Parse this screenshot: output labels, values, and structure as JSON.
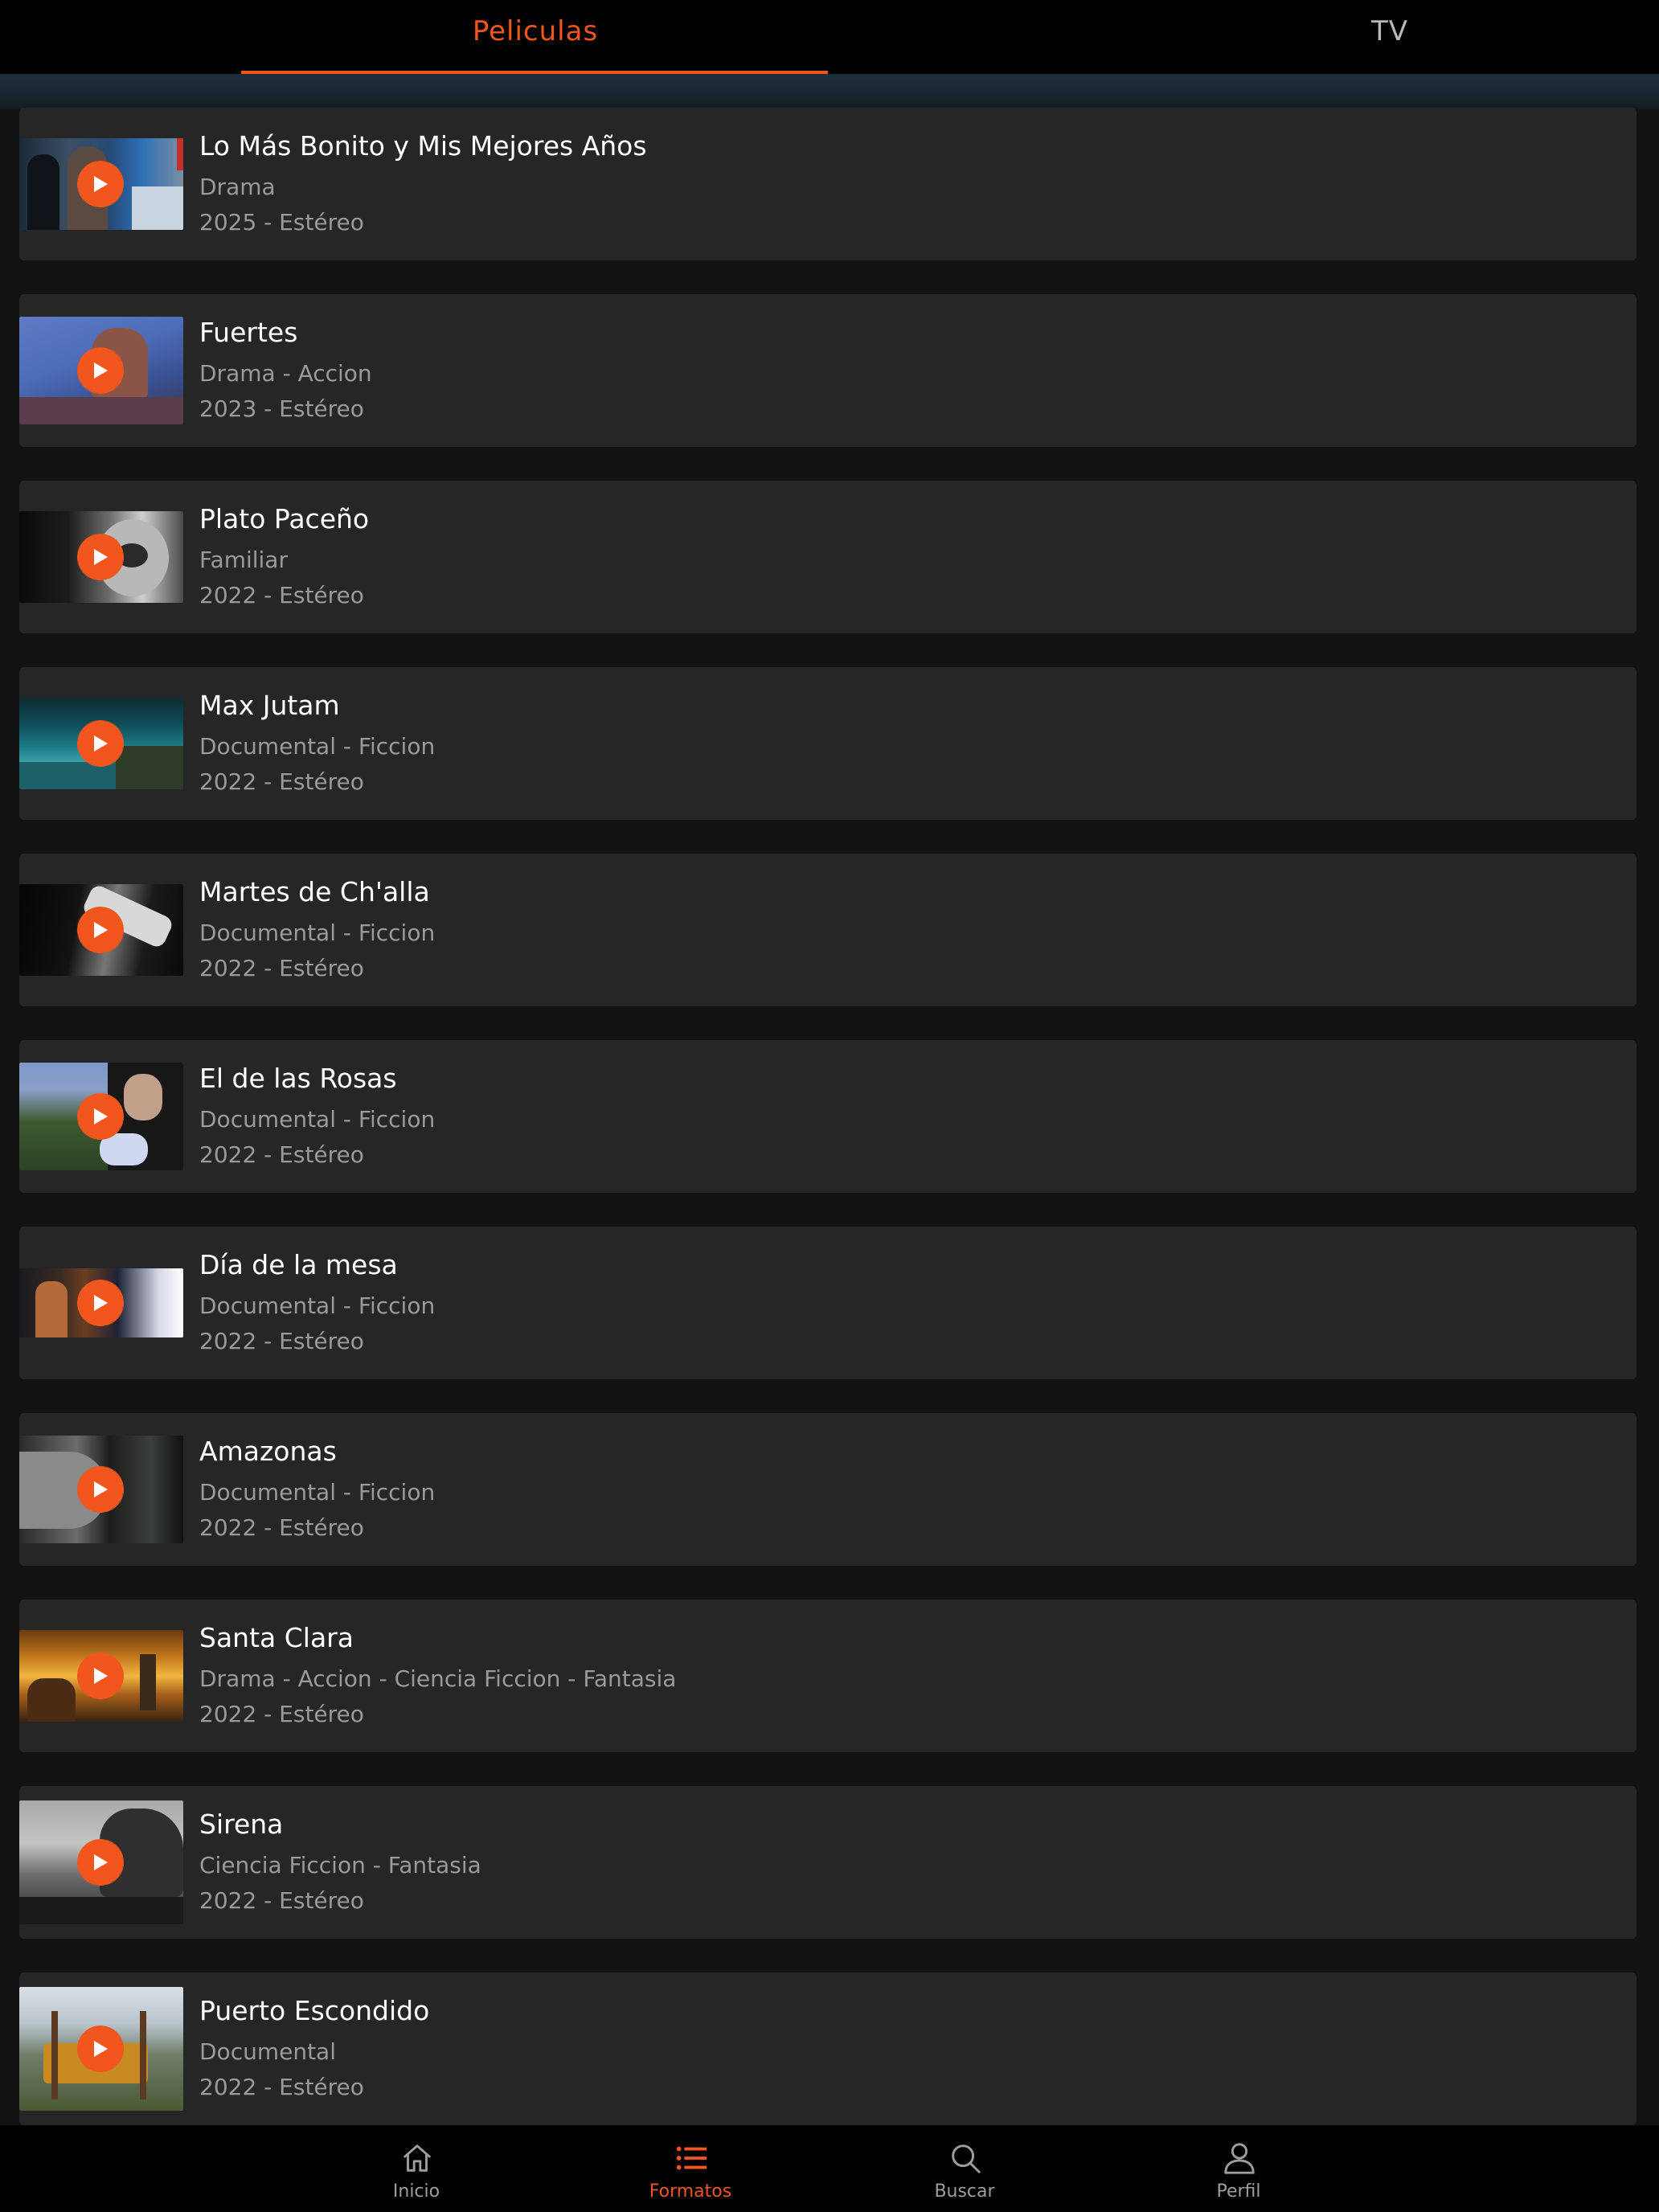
{
  "theme": {
    "accent": "#f0561e",
    "card_bg": "#262626",
    "page_bg": "#121212",
    "bar_bg": "#000000"
  },
  "top_tabs": [
    {
      "label": "Peliculas",
      "active": true
    },
    {
      "label": "TV",
      "active": false
    }
  ],
  "items": [
    {
      "title": "Lo Más Bonito y Mis Mejores Años",
      "genres": "Drama",
      "meta": "2025 - Estéreo",
      "thumbnail": "movie-still-thumbnail"
    },
    {
      "title": "Fuertes",
      "genres": "Drama - Accion",
      "meta": "2023 - Estéreo",
      "thumbnail": "movie-still-thumbnail"
    },
    {
      "title": "Plato Paceño",
      "genres": "Familiar",
      "meta": "2022 - Estéreo",
      "thumbnail": "movie-still-thumbnail"
    },
    {
      "title": "Max Jutam",
      "genres": "Documental - Ficcion",
      "meta": "2022 - Estéreo",
      "thumbnail": "movie-still-thumbnail"
    },
    {
      "title": "Martes de Ch'alla",
      "genres": "Documental - Ficcion",
      "meta": "2022 - Estéreo",
      "thumbnail": "movie-still-thumbnail"
    },
    {
      "title": "El de las Rosas",
      "genres": "Documental - Ficcion",
      "meta": "2022 - Estéreo",
      "thumbnail": "movie-still-thumbnail"
    },
    {
      "title": "Día de la mesa",
      "genres": "Documental - Ficcion",
      "meta": "2022 - Estéreo",
      "thumbnail": "movie-still-thumbnail"
    },
    {
      "title": "Amazonas",
      "genres": "Documental - Ficcion",
      "meta": "2022 - Estéreo",
      "thumbnail": "movie-still-thumbnail"
    },
    {
      "title": "Santa Clara",
      "genres": "Drama - Accion - Ciencia Ficcion - Fantasia",
      "meta": "2022 - Estéreo",
      "thumbnail": "movie-still-thumbnail"
    },
    {
      "title": "Sirena",
      "genres": "Ciencia Ficcion - Fantasia",
      "meta": "2022 - Estéreo",
      "thumbnail": "movie-still-thumbnail"
    },
    {
      "title": "Puerto Escondido",
      "genres": "Documental",
      "meta": "2022 - Estéreo",
      "thumbnail": "movie-still-thumbnail"
    }
  ],
  "bottom_nav": [
    {
      "label": "Inicio",
      "icon": "home-icon",
      "active": false
    },
    {
      "label": "Formatos",
      "icon": "list-icon",
      "active": true
    },
    {
      "label": "Buscar",
      "icon": "search-icon",
      "active": false
    },
    {
      "label": "Perfil",
      "icon": "user-icon",
      "active": false
    }
  ]
}
